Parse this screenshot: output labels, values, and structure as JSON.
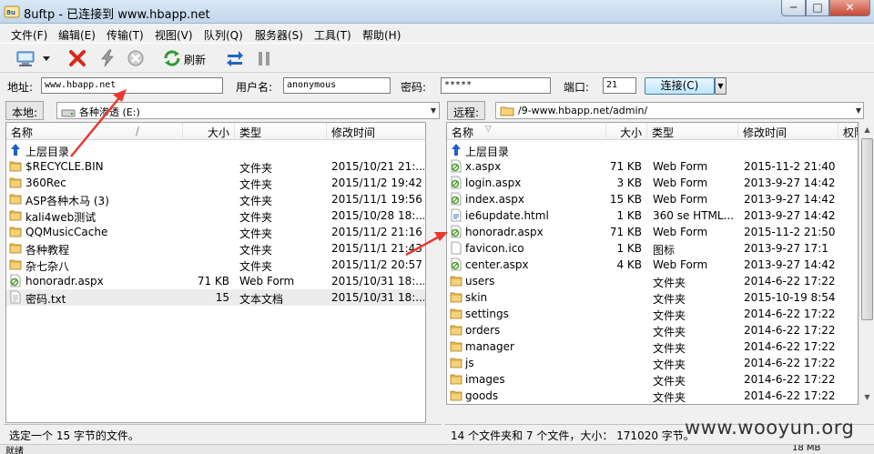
{
  "window": {
    "title": "8uftp - 已连接到 www.hbapp.net",
    "min_glyph": "─",
    "max_glyph": "□",
    "close_glyph": "✕"
  },
  "menu": [
    {
      "label": "文件(F)"
    },
    {
      "label": "编辑(E)"
    },
    {
      "label": "传输(T)"
    },
    {
      "label": "视图(V)"
    },
    {
      "label": "队列(Q)"
    },
    {
      "label": "服务器(S)"
    },
    {
      "label": "工具(T)"
    },
    {
      "label": "帮助(H)"
    }
  ],
  "toolbar": {
    "refresh_label": "刷新",
    "icons": [
      "site-manager-icon",
      "dropdown-icon",
      "disconnect-icon",
      "reconnect-icon",
      "stop-icon",
      "refresh-icon",
      "transfer-icon",
      "pause-icon"
    ]
  },
  "connection": {
    "address_label": "地址:",
    "address_value": "www.hbapp.net",
    "user_label": "用户名:",
    "user_value": "anonymous",
    "password_label": "密码:",
    "password_value": "*****",
    "port_label": "端口:",
    "port_value": "21",
    "connect_label": "连接(C)"
  },
  "local": {
    "label": "本地:",
    "path": "各种渗透  (E:)",
    "columns": [
      "名称",
      "大小",
      "类型",
      "修改时间"
    ],
    "sort_glyph": "/",
    "parent_label": "上层目录",
    "rows": [
      {
        "name": "$RECYCLE.BIN",
        "size": "",
        "type": "文件夹",
        "date": "2015/10/21 21:...",
        "icon": "folder"
      },
      {
        "name": "360Rec",
        "size": "",
        "type": "文件夹",
        "date": "2015/11/2 19:42",
        "icon": "folder"
      },
      {
        "name": "ASP各种木马 (3)",
        "size": "",
        "type": "文件夹",
        "date": "2015/11/1 19:56",
        "icon": "folder"
      },
      {
        "name": "kali4web测试",
        "size": "",
        "type": "文件夹",
        "date": "2015/10/28 18:...",
        "icon": "folder"
      },
      {
        "name": "QQMusicCache",
        "size": "",
        "type": "文件夹",
        "date": "2015/11/2 21:16",
        "icon": "folder"
      },
      {
        "name": "各种教程",
        "size": "",
        "type": "文件夹",
        "date": "2015/11/1 21:43",
        "icon": "folder"
      },
      {
        "name": "杂七杂八",
        "size": "",
        "type": "文件夹",
        "date": "2015/11/2 20:57",
        "icon": "folder"
      },
      {
        "name": "honoradr.aspx",
        "size": "71 KB",
        "type": "Web Form",
        "date": "2015/10/31 18:...",
        "icon": "aspx"
      },
      {
        "name": "密码.txt",
        "size": "15",
        "type": "文本文档",
        "date": "2015/10/31 18:...",
        "icon": "txt"
      }
    ],
    "status": "选定一个 15 字节的文件。"
  },
  "remote": {
    "label": "远程:",
    "path": "/9-www.hbapp.net/admin/",
    "columns": [
      "名称",
      "大小",
      "类型",
      "修改时间",
      "权限"
    ],
    "sort_glyph": "▽",
    "parent_label": "上层目录",
    "rows": [
      {
        "name": "x.aspx",
        "size": "71 KB",
        "type": "Web Form",
        "date": "2015-11-2 21:40",
        "icon": "aspx"
      },
      {
        "name": "login.aspx",
        "size": "3 KB",
        "type": "Web Form",
        "date": "2013-9-27 14:42",
        "icon": "aspx"
      },
      {
        "name": "index.aspx",
        "size": "15 KB",
        "type": "Web Form",
        "date": "2013-9-27 14:42",
        "icon": "aspx"
      },
      {
        "name": "ie6update.html",
        "size": "1 KB",
        "type": "360 se HTML...",
        "date": "2013-9-27 14:42",
        "icon": "html"
      },
      {
        "name": "honoradr.aspx",
        "size": "71 KB",
        "type": "Web Form",
        "date": "2015-11-2 21:50",
        "icon": "aspx"
      },
      {
        "name": "favicon.ico",
        "size": "1 KB",
        "type": "图标",
        "date": "2013-9-27 17:1",
        "icon": "ico"
      },
      {
        "name": "center.aspx",
        "size": "4 KB",
        "type": "Web Form",
        "date": "2013-9-27 14:42",
        "icon": "aspx"
      },
      {
        "name": "users",
        "size": "",
        "type": "文件夹",
        "date": "2014-6-22 17:22",
        "icon": "folder"
      },
      {
        "name": "skin",
        "size": "",
        "type": "文件夹",
        "date": "2015-10-19 8:54",
        "icon": "folder"
      },
      {
        "name": "settings",
        "size": "",
        "type": "文件夹",
        "date": "2014-6-22 17:22",
        "icon": "folder"
      },
      {
        "name": "orders",
        "size": "",
        "type": "文件夹",
        "date": "2014-6-22 17:22",
        "icon": "folder"
      },
      {
        "name": "manager",
        "size": "",
        "type": "文件夹",
        "date": "2014-6-22 17:22",
        "icon": "folder"
      },
      {
        "name": "js",
        "size": "",
        "type": "文件夹",
        "date": "2014-6-22 17:22",
        "icon": "folder"
      },
      {
        "name": "images",
        "size": "",
        "type": "文件夹",
        "date": "2014-6-22 17:22",
        "icon": "folder"
      },
      {
        "name": "goods",
        "size": "",
        "type": "文件夹",
        "date": "2014-6-22 17:22",
        "icon": "folder"
      }
    ],
    "status": "14 个文件夹和 7 个文件，大小： 171020 字节。"
  },
  "bottom": {
    "left_text": "就绪",
    "right_text": "18 MB"
  },
  "watermark": "www.wooyun.org",
  "colors": {
    "annotation_arrow": "#e8392f",
    "folder": "#e8b84a",
    "aspx_icon": "#4a9a2e"
  }
}
